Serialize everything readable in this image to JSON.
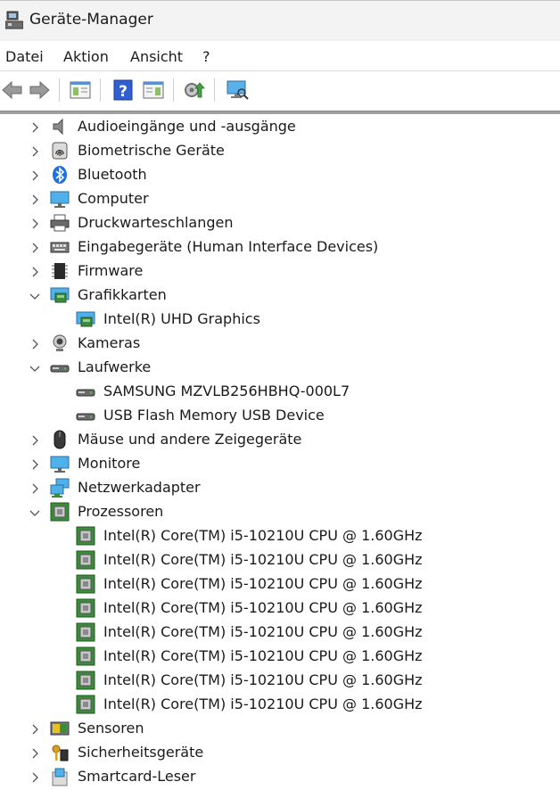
{
  "window": {
    "title": "Geräte-Manager",
    "app_icon": "device-manager-icon"
  },
  "menu": {
    "items": [
      "Datei",
      "Aktion",
      "Ansicht",
      "?"
    ]
  },
  "toolbar": {
    "buttons": [
      "back-arrow-icon",
      "forward-arrow-icon",
      "show-hide-tree-icon",
      "help-icon",
      "properties-icon",
      "update-driver-icon",
      "scan-hardware-icon"
    ]
  },
  "tree": {
    "categories": [
      {
        "label": "Audioeingänge und -ausgänge",
        "icon": "speaker-icon",
        "expanded": false
      },
      {
        "label": "Biometrische Geräte",
        "icon": "fingerprint-icon",
        "expanded": false
      },
      {
        "label": "Bluetooth",
        "icon": "bluetooth-icon",
        "expanded": false
      },
      {
        "label": "Computer",
        "icon": "computer-icon",
        "expanded": false
      },
      {
        "label": "Druckwarteschlangen",
        "icon": "printer-icon",
        "expanded": false
      },
      {
        "label": "Eingabegeräte (Human Interface Devices)",
        "icon": "keyboard-icon",
        "expanded": false
      },
      {
        "label": "Firmware",
        "icon": "firmware-icon",
        "expanded": false
      },
      {
        "label": "Grafikkarten",
        "icon": "display-adapter-icon",
        "expanded": true,
        "children": [
          "Intel(R) UHD Graphics"
        ]
      },
      {
        "label": "Kameras",
        "icon": "camera-icon",
        "expanded": false
      },
      {
        "label": "Laufwerke",
        "icon": "drive-icon",
        "expanded": true,
        "children": [
          "SAMSUNG MZVLB256HBHQ-000L7",
          "USB Flash Memory USB Device"
        ]
      },
      {
        "label": "Mäuse und andere Zeigegeräte",
        "icon": "mouse-icon",
        "expanded": false
      },
      {
        "label": "Monitore",
        "icon": "monitor-icon",
        "expanded": false
      },
      {
        "label": "Netzwerkadapter",
        "icon": "network-adapter-icon",
        "expanded": false
      },
      {
        "label": "Prozessoren",
        "icon": "processor-icon",
        "expanded": true,
        "children": [
          "Intel(R) Core(TM) i5-10210U CPU @ 1.60GHz",
          "Intel(R) Core(TM) i5-10210U CPU @ 1.60GHz",
          "Intel(R) Core(TM) i5-10210U CPU @ 1.60GHz",
          "Intel(R) Core(TM) i5-10210U CPU @ 1.60GHz",
          "Intel(R) Core(TM) i5-10210U CPU @ 1.60GHz",
          "Intel(R) Core(TM) i5-10210U CPU @ 1.60GHz",
          "Intel(R) Core(TM) i5-10210U CPU @ 1.60GHz",
          "Intel(R) Core(TM) i5-10210U CPU @ 1.60GHz"
        ]
      },
      {
        "label": "Sensoren",
        "icon": "sensor-icon",
        "expanded": false
      },
      {
        "label": "Sicherheitsgeräte",
        "icon": "security-device-icon",
        "expanded": false
      },
      {
        "label": "Smartcard-Leser",
        "icon": "smartcard-reader-icon",
        "expanded": false
      }
    ]
  },
  "colors": {
    "accent": "#0078d4",
    "chip_green": "#3c8a3c",
    "chevron": "#555555"
  }
}
